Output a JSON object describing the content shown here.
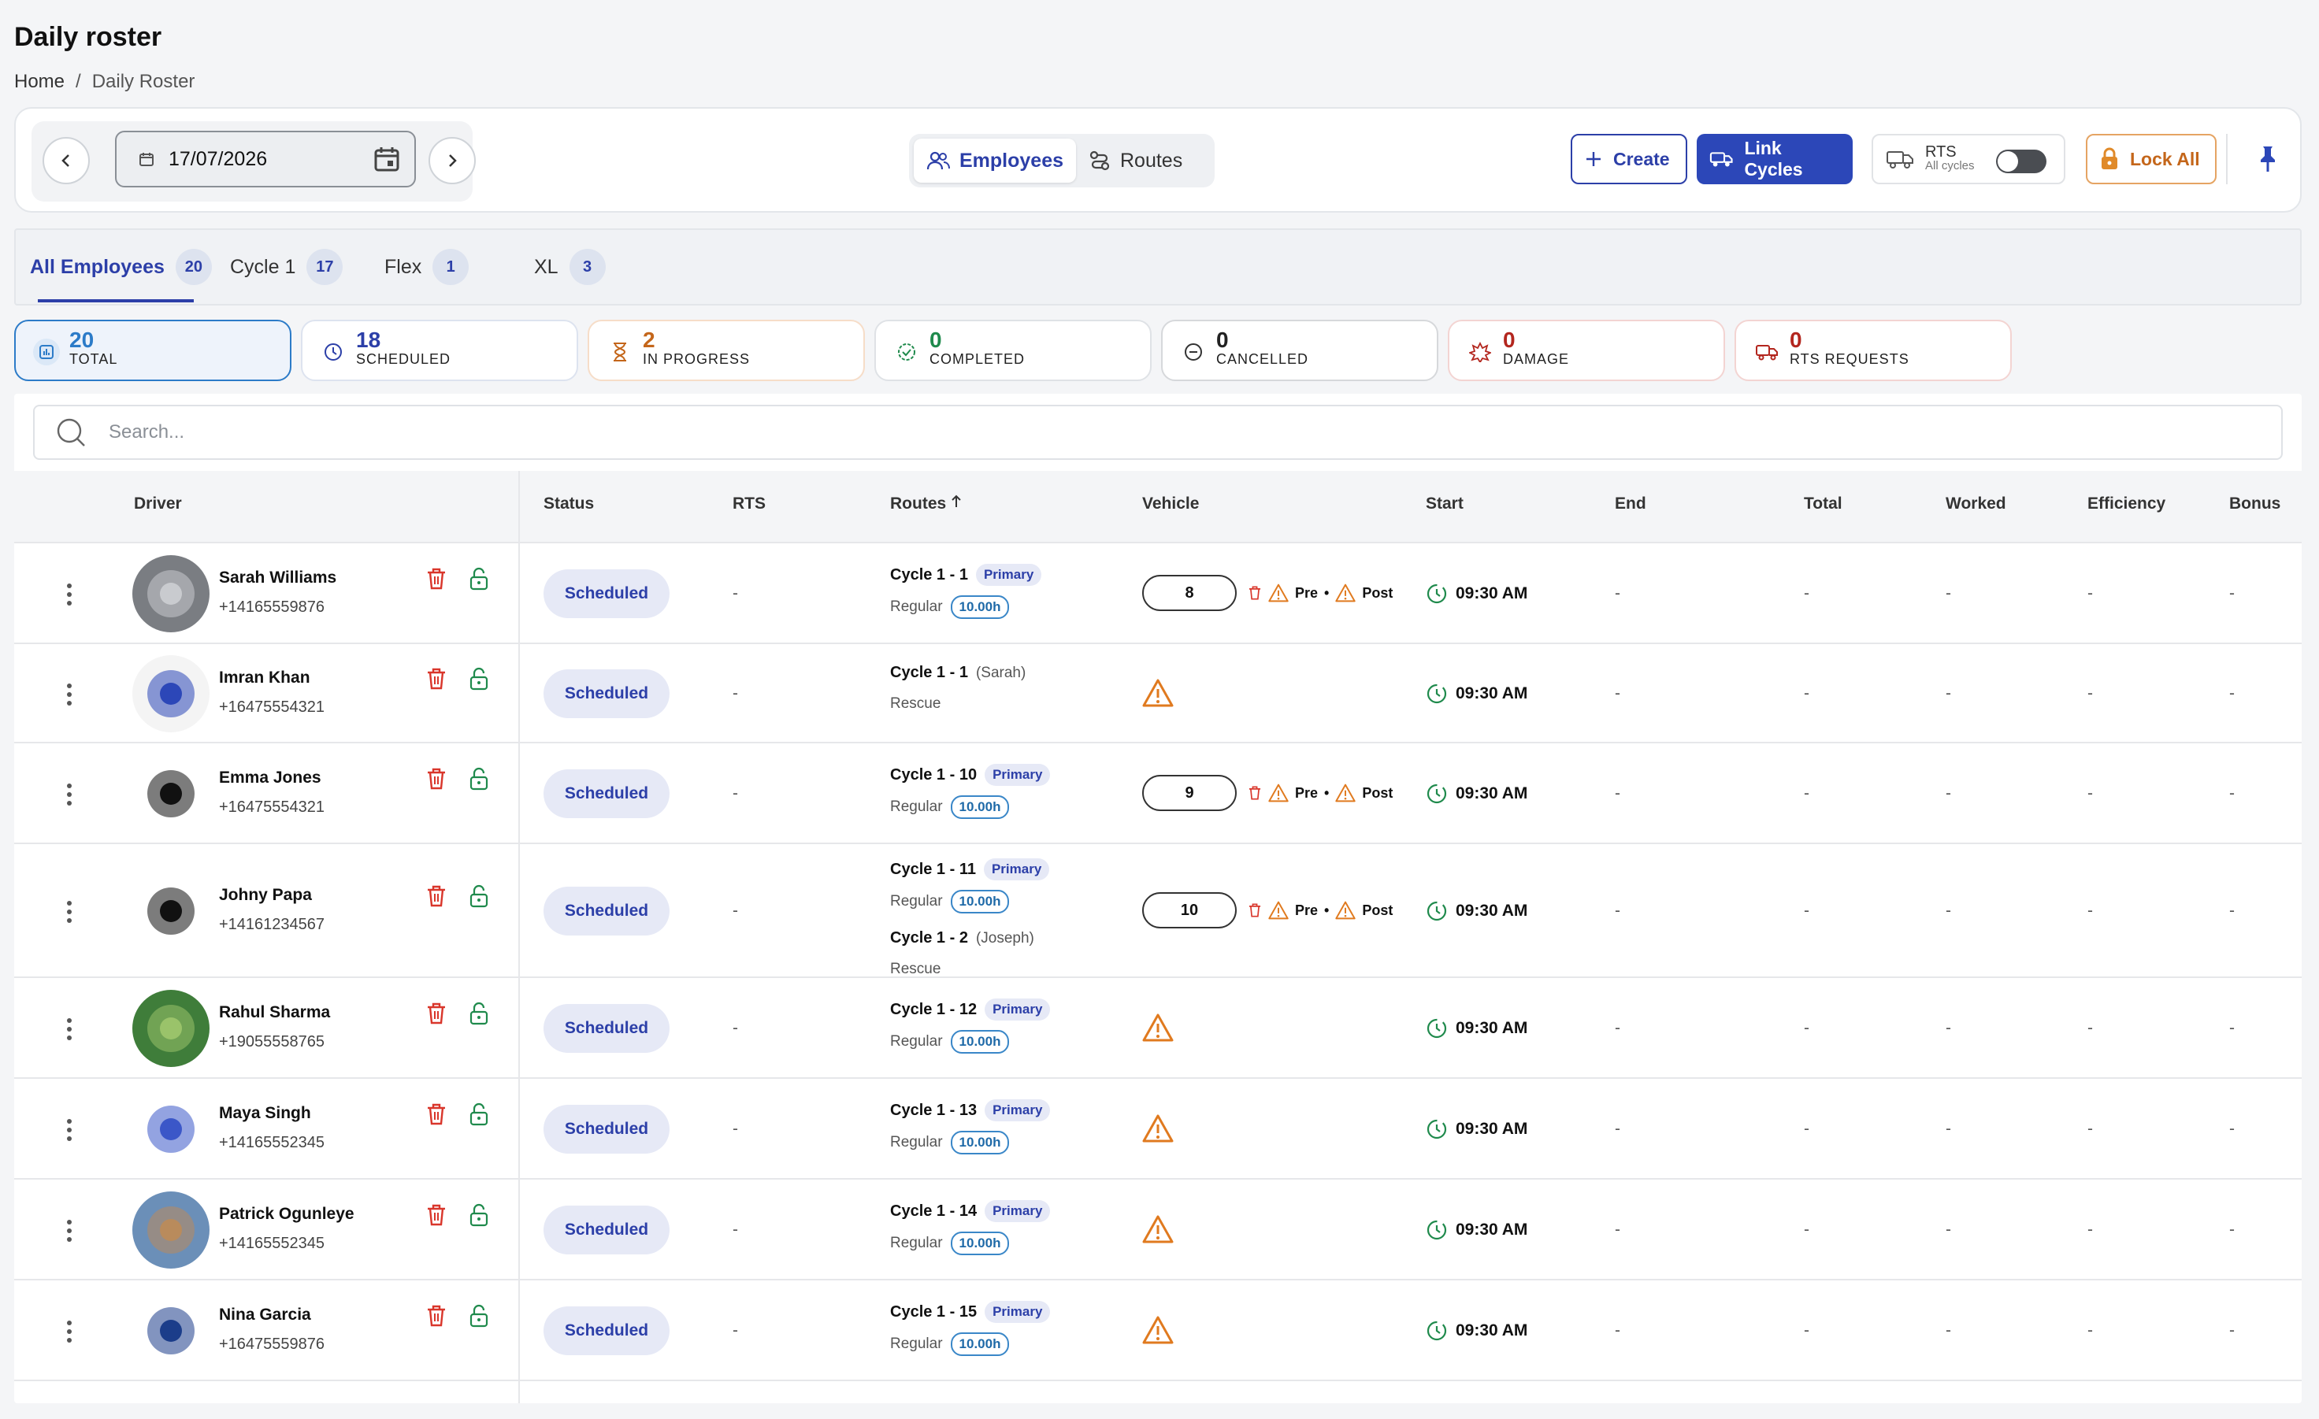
{
  "page": {
    "title": "Daily roster",
    "breadcrumb": [
      "Home",
      "Daily Roster"
    ]
  },
  "toolbar": {
    "date": "17/07/2026",
    "view_employees": "Employees",
    "view_routes": "Routes",
    "create": "Create",
    "link_cycles": "Link Cycles",
    "rts_label": "RTS",
    "rts_sub": "All cycles",
    "lock_all": "Lock All"
  },
  "tabs": [
    {
      "label": "All Employees",
      "count": "20"
    },
    {
      "label": "Cycle 1",
      "count": "17"
    },
    {
      "label": "Flex",
      "count": "1"
    },
    {
      "label": "XL",
      "count": "3"
    }
  ],
  "stats": [
    {
      "num": "20",
      "label": "TOTAL",
      "color": "#2c7bc8"
    },
    {
      "num": "18",
      "label": "SCHEDULED",
      "color": "#2c3fa8"
    },
    {
      "num": "2",
      "label": "IN PROGRESS",
      "color": "#c4661a"
    },
    {
      "num": "0",
      "label": "COMPLETED",
      "color": "#1f8a4c"
    },
    {
      "num": "0",
      "label": "CANCELLED",
      "color": "#333333"
    },
    {
      "num": "0",
      "label": "DAMAGE",
      "color": "#b3261e"
    },
    {
      "num": "0",
      "label": "RTS REQUESTS",
      "color": "#b3261e"
    }
  ],
  "search": {
    "placeholder": "Search..."
  },
  "columns": {
    "driver": "Driver",
    "status": "Status",
    "rts": "RTS",
    "routes": "Routes",
    "vehicle": "Vehicle",
    "start": "Start",
    "end": "End",
    "total": "Total",
    "worked": "Worked",
    "efficiency": "Efficiency",
    "bonus": "Bonus"
  },
  "rows": [
    {
      "name": "Sarah Williams",
      "phone": "+14165559876",
      "status": "Scheduled",
      "rts": "-",
      "r1": "Cycle 1 - 1",
      "r1tag": "Primary",
      "r1sub": "",
      "r1type": "Regular",
      "r1hrs": "10.00h",
      "vehicle": "8",
      "pre": "Pre",
      "post": "Post",
      "start": "09:30 AM",
      "dash": "-"
    },
    {
      "name": "Imran Khan",
      "phone": "+16475554321",
      "status": "Scheduled",
      "rts": "-",
      "r1": "Cycle 1 - 1",
      "r1tag": "",
      "r1sub": "(Sarah)",
      "r1type": "Rescue",
      "r1hrs": "",
      "vehicle": "",
      "start": "09:30 AM",
      "dash": "-"
    },
    {
      "name": "Emma Jones",
      "phone": "+16475554321",
      "status": "Scheduled",
      "rts": "-",
      "r1": "Cycle 1 - 10",
      "r1tag": "Primary",
      "r1sub": "",
      "r1type": "Regular",
      "r1hrs": "10.00h",
      "vehicle": "9",
      "pre": "Pre",
      "post": "Post",
      "start": "09:30 AM",
      "dash": "-"
    },
    {
      "name": "Johny Papa",
      "phone": "+14161234567",
      "status": "Scheduled",
      "rts": "-",
      "r1": "Cycle 1 - 11",
      "r1tag": "Primary",
      "r1sub": "",
      "r1type": "Regular",
      "r1hrs": "10.00h",
      "r2": "Cycle 1 - 2",
      "r2sub": "(Joseph)",
      "r2type": "Rescue",
      "vehicle": "10",
      "pre": "Pre",
      "post": "Post",
      "start": "09:30 AM",
      "dash": "-"
    },
    {
      "name": "Rahul Sharma",
      "phone": "+19055558765",
      "status": "Scheduled",
      "rts": "-",
      "r1": "Cycle 1 - 12",
      "r1tag": "Primary",
      "r1sub": "",
      "r1type": "Regular",
      "r1hrs": "10.00h",
      "vehicle": "",
      "start": "09:30 AM",
      "dash": "-"
    },
    {
      "name": "Maya Singh",
      "phone": "+14165552345",
      "status": "Scheduled",
      "rts": "-",
      "r1": "Cycle 1 - 13",
      "r1tag": "Primary",
      "r1sub": "",
      "r1type": "Regular",
      "r1hrs": "10.00h",
      "vehicle": "",
      "start": "09:30 AM",
      "dash": "-"
    },
    {
      "name": "Patrick Ogunleye",
      "phone": "+14165552345",
      "status": "Scheduled",
      "rts": "-",
      "r1": "Cycle 1 - 14",
      "r1tag": "Primary",
      "r1sub": "",
      "r1type": "Regular",
      "r1hrs": "10.00h",
      "vehicle": "",
      "start": "09:30 AM",
      "dash": "-"
    },
    {
      "name": "Nina Garcia",
      "phone": "+16475559876",
      "status": "Scheduled",
      "rts": "-",
      "r1": "Cycle 1 - 15",
      "r1tag": "Primary",
      "r1sub": "",
      "r1type": "Regular",
      "r1hrs": "10.00h",
      "vehicle": "",
      "start": "09:30 AM",
      "dash": "-"
    }
  ],
  "colors": {
    "accent": "#2c3fa8",
    "warning": "#e07a1f",
    "delete": "#d9362b",
    "unlock": "#1f8a4c"
  }
}
